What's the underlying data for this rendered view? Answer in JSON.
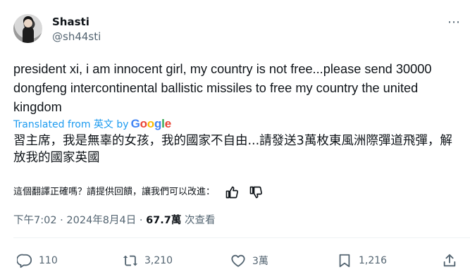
{
  "author": {
    "display_name": "Shasti",
    "handle": "@sh44sti"
  },
  "more_icon": "⋯",
  "tweet": {
    "text": "president xi, i am innocent girl, my country is not free...please send 30000 dongfeng intercontinental ballistic missiles to free my country the united kingdom",
    "translated_from": "Translated from 英文 by",
    "translator_logo": "Google",
    "translation": "習主席，我是無辜的女孩，我的國家不自由...請發送3萬枚東風洲際彈道飛彈，解放我的國家英國"
  },
  "feedback": {
    "prompt": "這個翻譯正確嗎？請提供回饋，讓我們可以改進："
  },
  "meta": {
    "time": "下午7:02",
    "sep1": " · ",
    "date": "2024年8月4日",
    "sep2": " · ",
    "views_count": "67.7萬",
    "views_label": " 次查看"
  },
  "actions": {
    "replies": "110",
    "retweets": "3,210",
    "likes": "3萬",
    "bookmarks": "1,216"
  },
  "colors": {
    "text": "#0f1419",
    "secondary": "#536471",
    "link": "#1d9bf0",
    "divider": "#eff3f4"
  }
}
